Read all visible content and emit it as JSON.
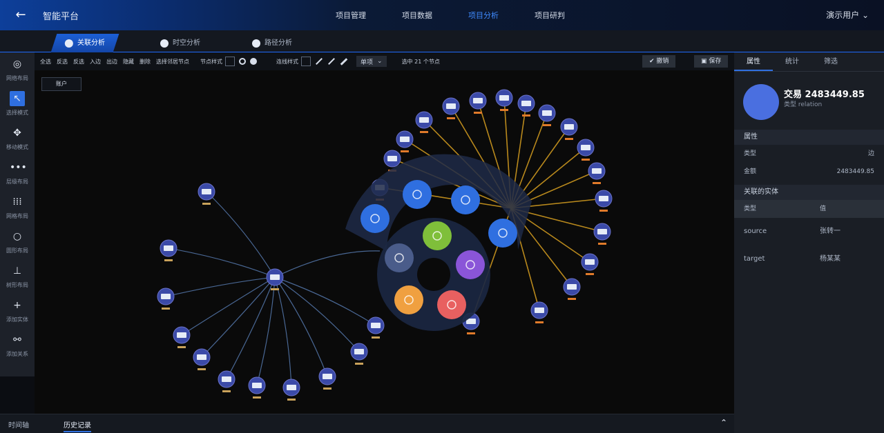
{
  "header": {
    "app_title": "智能平台",
    "nav": [
      "项目管理",
      "项目数据",
      "项目分析",
      "项目研判"
    ],
    "active_nav": 2,
    "user": "演示用户"
  },
  "tabs": [
    {
      "label": "关联分析",
      "icon": "link-icon",
      "active": true
    },
    {
      "label": "时空分析",
      "icon": "globe-icon",
      "active": false
    },
    {
      "label": "路径分析",
      "icon": "share-icon",
      "active": false
    }
  ],
  "left_toolbar": [
    {
      "label": "网络布局",
      "icon": "layout-icon"
    },
    {
      "label": "选择模式",
      "icon": "pointer-icon"
    },
    {
      "label": "移动模式",
      "icon": "move-icon"
    },
    {
      "label": "层级布局",
      "icon": "dots-icon"
    },
    {
      "label": "网格布局",
      "icon": "grid-icon"
    },
    {
      "label": "圆形布局",
      "icon": "circle-icon"
    },
    {
      "label": "树形布局",
      "icon": "tree-icon"
    },
    {
      "label": "添加实体",
      "icon": "plus-icon"
    },
    {
      "label": "添加关系",
      "icon": "relation-icon"
    }
  ],
  "toolbar2": {
    "actions": [
      "全选",
      "反选",
      "反选",
      "入边",
      "出边",
      "隐藏",
      "删除",
      "选择邻居节点"
    ],
    "node_style_label": "节点样式",
    "edge_style_label": "连线样式",
    "select_value": "单项",
    "status": "选中 21 个节点",
    "undo_label": "撤销",
    "save_label": "保存"
  },
  "canvas": {
    "tag": "账户"
  },
  "right_panel": {
    "tabs": [
      "属性",
      "统计",
      "筛选"
    ],
    "entity_name": "交易 2483449.85",
    "entity_type": "类型 relation",
    "attr_head": "属性",
    "attrs": [
      {
        "k": "类型",
        "v": "边"
      },
      {
        "k": "金额",
        "v": "2483449.85"
      }
    ],
    "rel_head": "关联的实体",
    "rel_header": {
      "k": "类型",
      "v": "值"
    },
    "rel_rows": [
      {
        "k": "source",
        "v": "张转一"
      },
      {
        "k": "target",
        "v": "杨某某"
      }
    ]
  },
  "bottom": {
    "items": [
      "时间轴",
      "历史记录"
    ],
    "active": 1
  },
  "colors": {
    "accent": "#2f6fe0",
    "edge_left": "#5a7fb8",
    "edge_right": "#d8a020",
    "menu_green": "#7fbf3a",
    "menu_purple": "#8a55d8",
    "menu_red": "#e86060",
    "menu_orange": "#f0a040",
    "menu_gray": "#4a5c8a"
  }
}
